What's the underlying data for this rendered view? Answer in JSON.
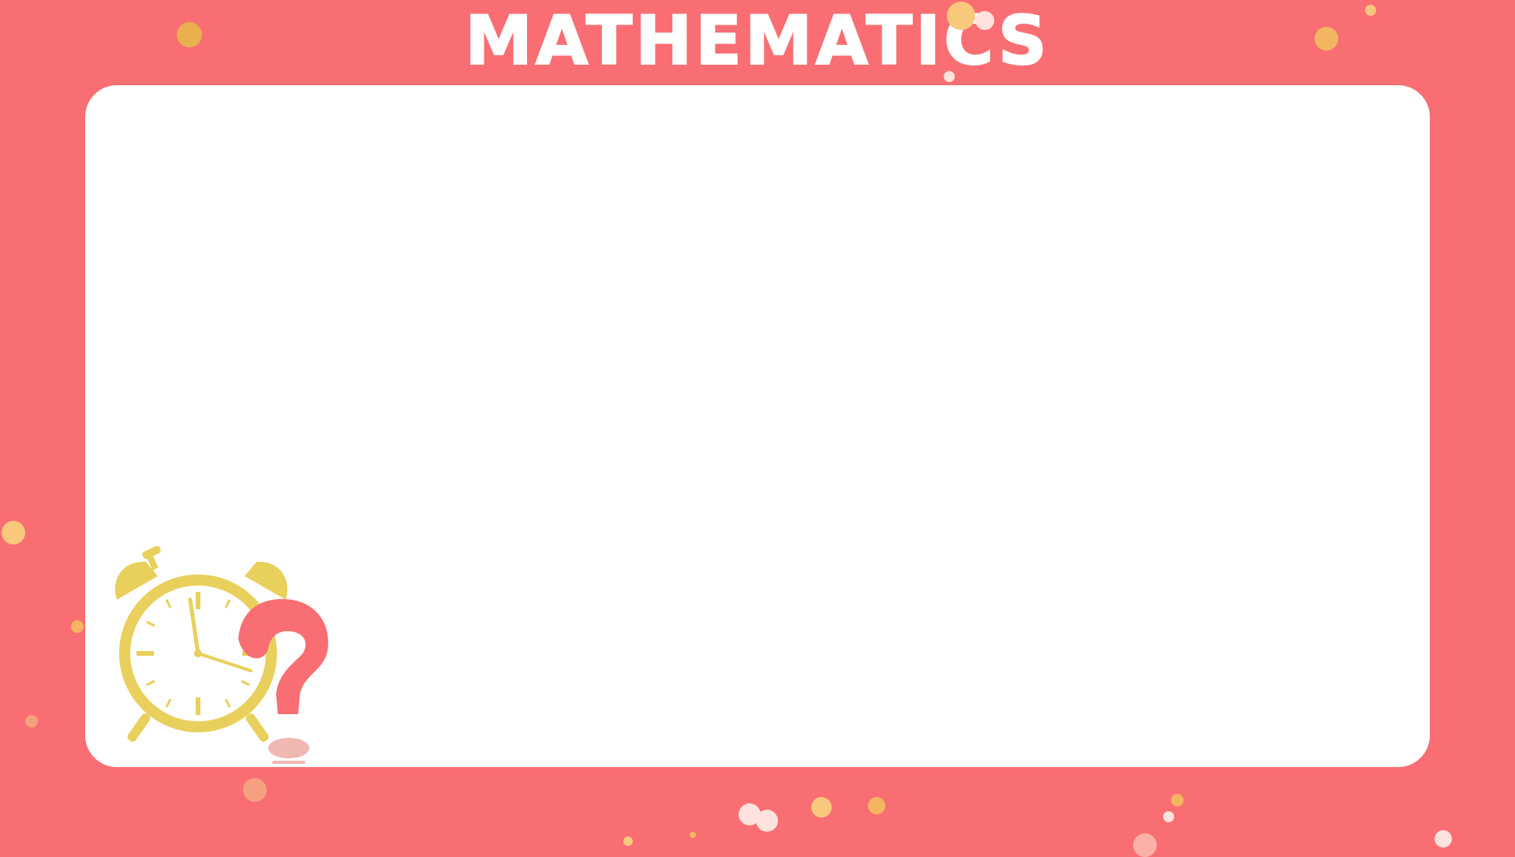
{
  "header": {
    "title": "MATHEMATICS"
  },
  "decor": {
    "colors": {
      "background": "#f96e72",
      "panel": "#ffffff",
      "clock": "#e9cf5c",
      "question_mark": "#f96e72"
    },
    "icons": [
      "alarm-clock-icon",
      "question-mark-icon"
    ]
  }
}
